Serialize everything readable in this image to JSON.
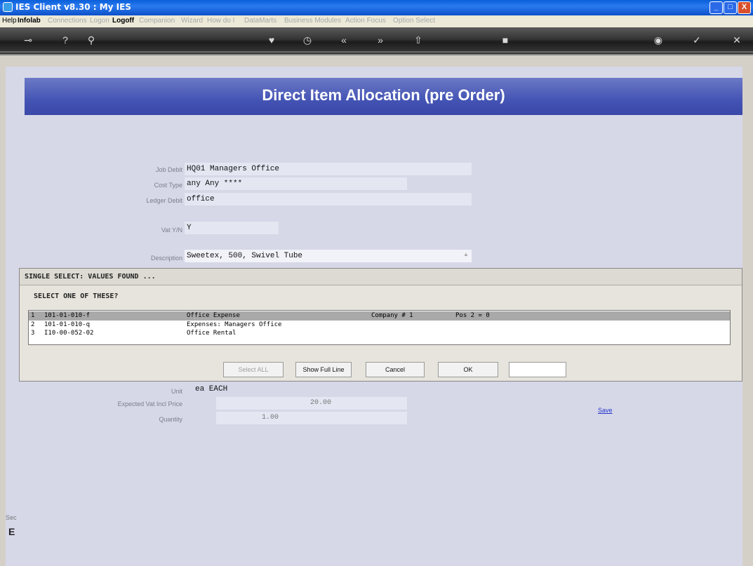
{
  "window": {
    "title": "IES Client v8.30 : My IES",
    "buttons": {
      "minimize": "_",
      "maximize": "□",
      "close": "X"
    }
  },
  "menu": [
    {
      "label": "Help",
      "enabled": true
    },
    {
      "label": "Infolab",
      "enabled": true
    },
    {
      "label": "Connections",
      "enabled": false
    },
    {
      "label": "Logon",
      "enabled": false
    },
    {
      "label": "Logoff",
      "enabled": true
    },
    {
      "label": "Companion",
      "enabled": false
    },
    {
      "label": "Wizard",
      "enabled": false
    },
    {
      "label": "How do I",
      "enabled": false
    },
    {
      "label": "DataMarts",
      "enabled": false
    },
    {
      "label": "Business Modules",
      "enabled": false
    },
    {
      "label": "Action Focus",
      "enabled": false
    },
    {
      "label": "Option Select",
      "enabled": false
    }
  ],
  "toolbar": [
    "key-icon",
    "help-icon",
    "search-icon",
    "heart-icon",
    "clock-icon",
    "back-icon",
    "forward-icon",
    "up-icon",
    "stop-icon",
    "globe-icon",
    "check-icon",
    "close-icon"
  ],
  "header": {
    "title": "Direct Item Allocation (pre Order)"
  },
  "form": {
    "job_debit": {
      "label": "Job Debit",
      "value": "HQ01 Managers Office"
    },
    "cost_type": {
      "label": "Cost Type",
      "value": "any Any ****"
    },
    "ledger_debit": {
      "label": "Ledger Debit",
      "value": "office"
    },
    "vat_yn": {
      "label": "Vat Y/N",
      "value": "Y"
    },
    "description": {
      "label": "Description",
      "value": "Sweetex, 500, Swivel Tube"
    },
    "unit": {
      "label": "Unit",
      "value": "ea EACH"
    },
    "expected_price": {
      "label": "Expected Vat Incl Price",
      "value": "20.00"
    },
    "quantity": {
      "label": "Quantity",
      "value": "1.00"
    },
    "save_link": "Save"
  },
  "popup": {
    "title": "SINGLE SELECT: VALUES FOUND ...",
    "prompt": "SELECT ONE OF THESE?",
    "rows": [
      {
        "num": "1",
        "code": "101-01-010-f",
        "desc": "Office Expense",
        "company": "Company # 1",
        "pos": "Pos 2 = 0",
        "selected": true
      },
      {
        "num": "2",
        "code": "101-01-010-q",
        "desc": "Expenses: Managers Office",
        "company": "",
        "pos": "",
        "selected": false
      },
      {
        "num": "3",
        "code": "I10-00-052-02",
        "desc": "Office Rental",
        "company": "",
        "pos": "",
        "selected": false
      }
    ],
    "buttons": {
      "select_all": "Select ALL",
      "show_full": "Show Full Line",
      "cancel": "Cancel",
      "ok": "OK"
    },
    "input_value": ""
  },
  "sidebar": {
    "label_1": "Sec",
    "label_2": "E"
  }
}
